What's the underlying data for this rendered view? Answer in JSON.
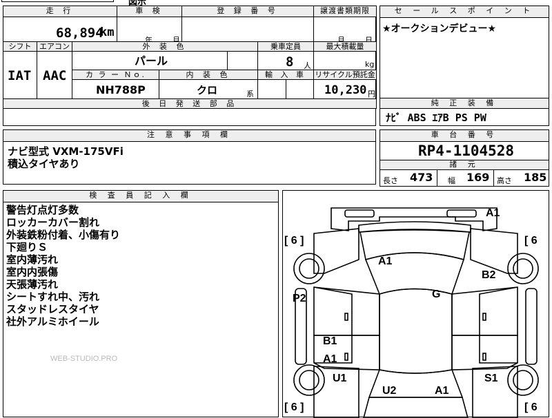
{
  "top_fragment": "図示",
  "mileage": {
    "label": "走 行",
    "value": "68,894",
    "unit": "km"
  },
  "inspection": {
    "label": "車 検",
    "year_unit": "年",
    "month_unit": "月"
  },
  "registration": {
    "label": "登 録 番 号"
  },
  "transfer": {
    "label": "譲渡書類期限",
    "month_unit": "月",
    "day_unit": "日"
  },
  "shift": {
    "label": "シフト",
    "value": "IAT"
  },
  "aircon": {
    "label": "エアコン",
    "value": "AAC"
  },
  "exterior": {
    "label": "外 装 色",
    "value": "パール"
  },
  "capacity": {
    "label": "乗車定員",
    "value": "8",
    "unit": "人"
  },
  "max_load": {
    "label": "最大積載量",
    "unit": "kg"
  },
  "color_no": {
    "label": "カ ラ ー Ｎｏ.",
    "value": "NH788P"
  },
  "interior": {
    "label": "内 装 色",
    "value": "クロ",
    "unit": "系"
  },
  "import": {
    "label": "輸 入 車"
  },
  "recycle": {
    "label": "リサイクル預託金",
    "value": "10,230",
    "unit": "円"
  },
  "later_parts": {
    "label": "後 日 発 送 部 品"
  },
  "sales_point": {
    "label": "セ ー ル ス ポ イ ン ト",
    "text": "★オークションデビュー★"
  },
  "equipment": {
    "label": "純 正 装 備",
    "text": "ﾅﾋﾞ ABS ｴｱB PS PW"
  },
  "notes": {
    "label": "注 意 事 項 欄",
    "lines": [
      "ナビ型式 VXM-175VFi",
      "積込タイヤあり"
    ]
  },
  "chassis": {
    "label": "車 台 番 号",
    "value": "RP4-1104528"
  },
  "specs": {
    "label": "諸 元",
    "length_label": "長さ",
    "length": "473",
    "width_label": "幅",
    "width": "169",
    "height_label": "高さ",
    "height": "185"
  },
  "inspector": {
    "label": "検 査 員 記 入 欄",
    "lines": [
      "警告灯点灯多数",
      "ロッカーカバー割れ",
      "外装鉄粉付着、小傷有り",
      "下廻りＳ",
      "室内薄汚れ",
      "室内内張傷",
      "天張薄汚れ",
      "シートすれ中、汚れ",
      "スタッドレスタイヤ",
      "社外アルミホイール"
    ]
  },
  "watermark": "WEB-STUDIO.PRO",
  "diagram": {
    "marks": {
      "a1_roof": "A1",
      "a1_hood": "A1",
      "b2": "B2",
      "p2": "P2",
      "g": "G",
      "b1": "B1",
      "a1_door": "A1",
      "u1": "U1",
      "s1": "S1",
      "u2": "U2",
      "a1_rear": "A1"
    },
    "tires": {
      "fl": "6",
      "fr": "6",
      "rl": "6",
      "rr": "6"
    }
  }
}
